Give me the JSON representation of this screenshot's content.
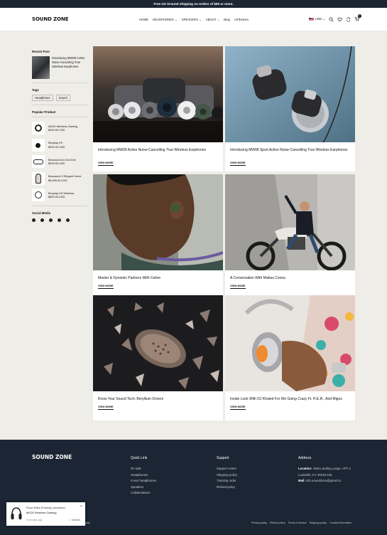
{
  "announcement": "Free US Ground shipping on orders of $99 or more.",
  "header": {
    "logo": "SOUND ZONE",
    "nav": [
      {
        "label": "HOME"
      },
      {
        "label": "HEADPHONES ⌄"
      },
      {
        "label": "SPEAKERS ⌄"
      },
      {
        "label": "ABOUT ⌄"
      },
      {
        "label": "Blog"
      },
      {
        "label": "All themes"
      }
    ],
    "currency": "USD ⌄",
    "cart_count": "0",
    "icons": [
      "search-icon",
      "heart-icon",
      "compare-icon",
      "cart-icon"
    ]
  },
  "sidebar": {
    "recent_title": "Recent Post",
    "recent_post": "Introducing MW09 Active Noise-Canceling True Wireless Earphones",
    "tags_title": "Tags",
    "tags": [
      "Headphone",
      "Sound"
    ],
    "popular_title": "Popular Product",
    "products": [
      {
        "name": "MG20 Wireless Gaming",
        "price": "$449.00 USD"
      },
      {
        "name": "Beoplay EX",
        "price": "$399.00 USD"
      },
      {
        "name": "Beosound A1 2nd Gen",
        "price": "$299.00 USD"
      },
      {
        "name": "Beosound 2 Elegant Home",
        "price": "$3,999.00 USD"
      },
      {
        "name": "Beoplay H9 Wireless",
        "price": "$699.00 USD"
      }
    ],
    "social_title": "Social Media"
  },
  "posts": [
    {
      "title": "Introducing MW09 Active Noise-Cancelling True Wireless Earphones",
      "more": "VIEW MORE"
    },
    {
      "title": "Introducing MW08 Sport Active Noise-Cancelling True Wireless Earphones",
      "more": "VIEW MORE"
    },
    {
      "title": "Master & Dynamic Partners With Celine",
      "more": "VIEW MORE"
    },
    {
      "title": "A Conversation With Matías Conea",
      "more": "VIEW MORE"
    },
    {
      "title": "Know Your Sound Tech: Beryllium Drivers",
      "more": "VIEW MORE"
    },
    {
      "title": "Inside Look With DJ Khaled For We Going Crazy Ft. H.E.R., And Migos",
      "more": "VIEW MORE"
    }
  ],
  "footer": {
    "logo": "SOUND ZONE",
    "quick_title": "Quick Link",
    "quick_links": [
      "On sale",
      "Headphones",
      "In-ear headphones",
      "Speakers",
      "Collaborations"
    ],
    "support_title": "Support",
    "support_links": [
      "Support center",
      "Shipping policy",
      "Tracking order",
      "Refund policy"
    ],
    "address_title": "Address",
    "location_label": "Location:",
    "location": "4455 Landing Lange, APT 4",
    "city": "Louisville, KY 40018-133",
    "mail_label": "Mail:",
    "mail": "info.soundzone@gmail.co",
    "copyright": "by Shopify",
    "bottom_links": [
      "Privacy policy",
      "Refund policy",
      "Terms of service",
      "Shipping policy",
      "Contact information"
    ]
  },
  "popup": {
    "line1": "Floyd Miles (Poland) purchased",
    "product": "MG20 Wireless Gaming",
    "time": "8 minutes ago",
    "verified": "Verified"
  }
}
